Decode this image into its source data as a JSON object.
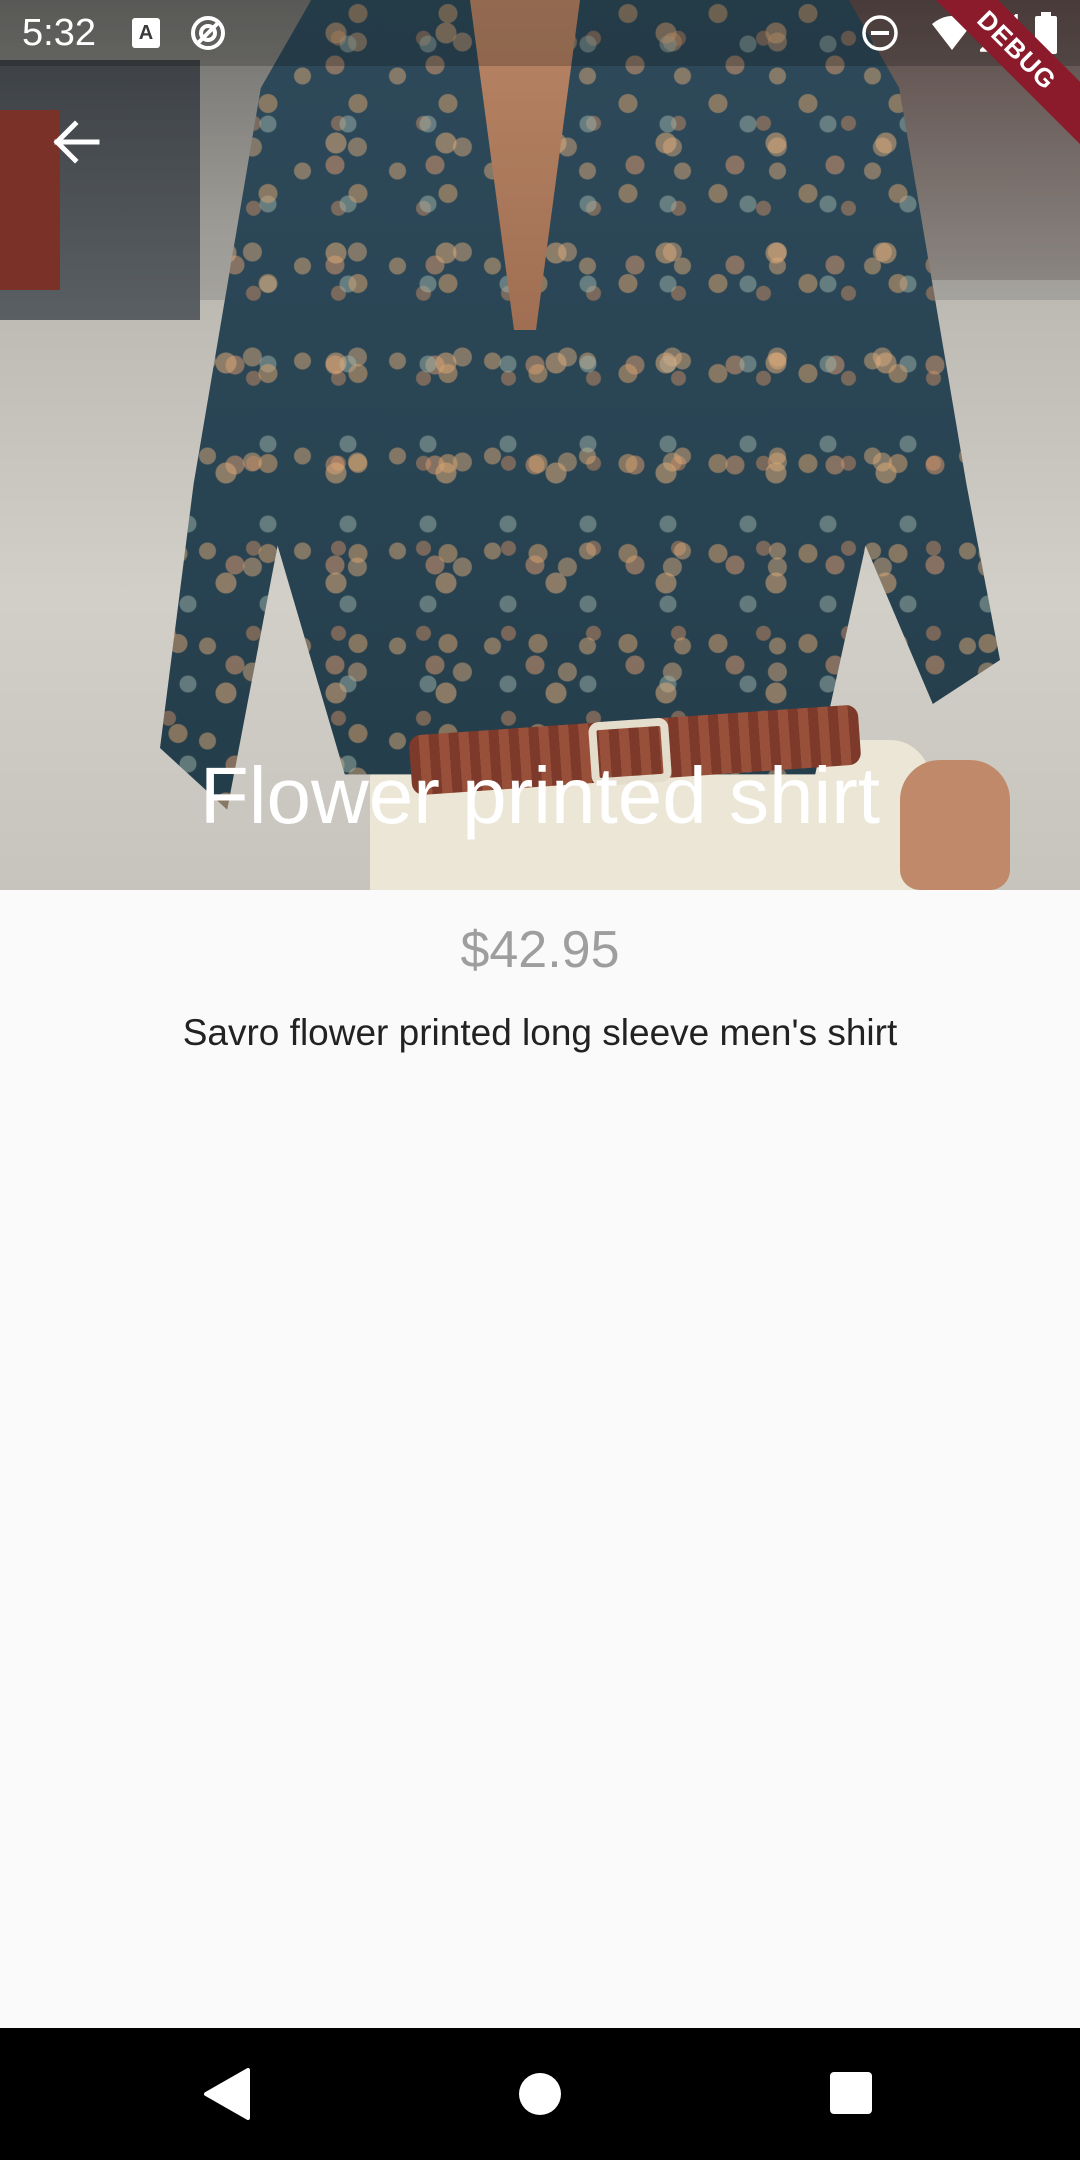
{
  "status_bar": {
    "time": "5:32",
    "left_icons": [
      "keyboard-a-icon",
      "sync-icon"
    ],
    "right_icons": [
      "do-not-disturb-icon",
      "wifi-icon",
      "signal-icon",
      "battery-icon"
    ],
    "debug_label": "DEBUG"
  },
  "app_bar": {
    "back_icon": "arrow-back-icon"
  },
  "product": {
    "title": "Flower printed shirt",
    "price": "$42.95",
    "description": "Savro flower printed long sleeve men's shirt"
  },
  "nav_bar": {
    "icons": [
      "nav-back-icon",
      "nav-home-icon",
      "nav-recent-icon"
    ]
  },
  "colors": {
    "background": "#fafafa",
    "price_text": "#9e9e9e",
    "description_text": "#222222",
    "debug_ribbon": "#8b1b2b",
    "nav_bar": "#000000"
  }
}
